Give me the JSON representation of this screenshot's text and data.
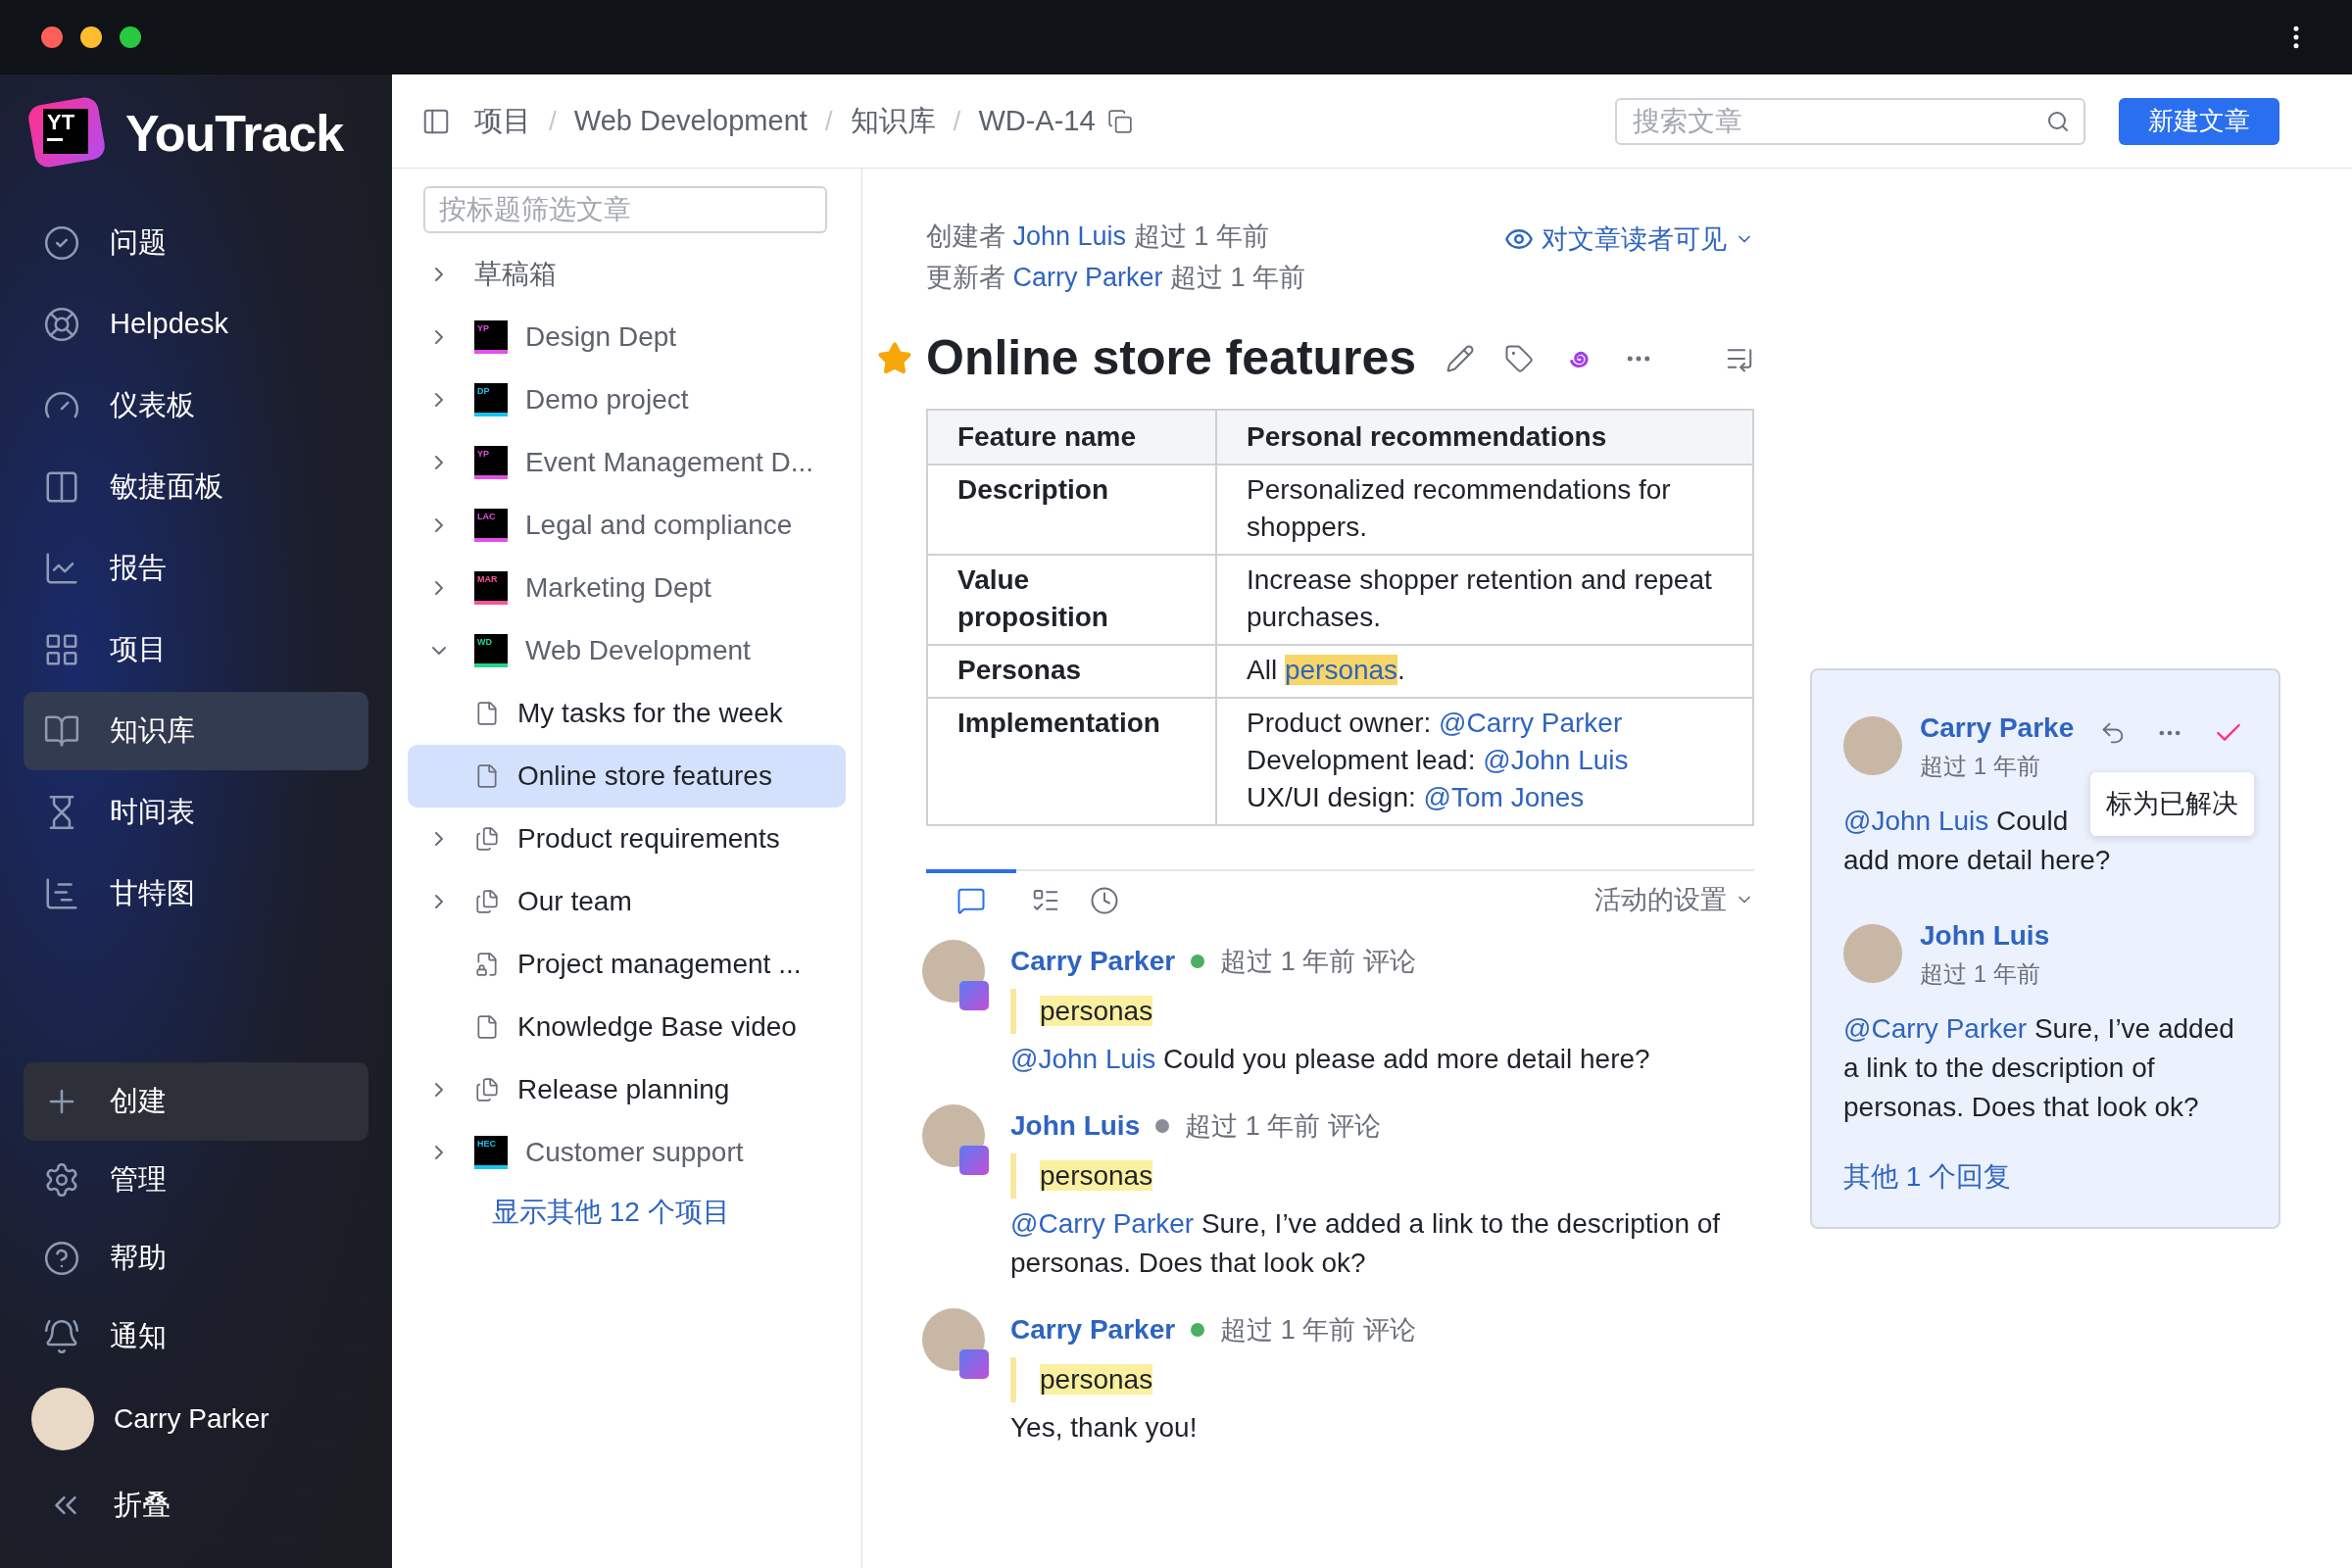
{
  "sidebar": {
    "logo_mark": "YT",
    "logo_text": "YouTrack",
    "nav": [
      {
        "label": "问题",
        "selected": false
      },
      {
        "label": "Helpdesk",
        "selected": false
      },
      {
        "label": "仪表板",
        "selected": false
      },
      {
        "label": "敏捷面板",
        "selected": false
      },
      {
        "label": "报告",
        "selected": false
      },
      {
        "label": "项目",
        "selected": false
      },
      {
        "label": "知识库",
        "selected": true
      },
      {
        "label": "时间表",
        "selected": false
      },
      {
        "label": "甘特图",
        "selected": false
      }
    ],
    "create": {
      "label": "创建"
    },
    "bottom": [
      {
        "label": "管理"
      },
      {
        "label": "帮助"
      },
      {
        "label": "通知"
      }
    ],
    "user": {
      "name": "Carry Parker"
    },
    "collapse": {
      "label": "折叠"
    }
  },
  "header": {
    "breadcrumb": [
      "项目",
      "Web Development",
      "知识库",
      "WD-A-14"
    ],
    "separator": "/",
    "search": {
      "placeholder": "搜索文章"
    },
    "new_button": "新建文章"
  },
  "tree": {
    "filter": {
      "placeholder": "按标题筛选文章"
    },
    "items": [
      {
        "kind": "folder",
        "label": "草稿箱",
        "expanded": false,
        "selected": false
      },
      {
        "kind": "project",
        "label": "Design Dept",
        "badge": "YP",
        "color": "#e34fe8",
        "expanded": false,
        "selected": false
      },
      {
        "kind": "project",
        "label": "Demo project",
        "badge": "DP",
        "color": "#19c3f0",
        "expanded": false,
        "selected": false
      },
      {
        "kind": "project",
        "label": "Event Management D...",
        "badge": "YP",
        "color": "#e34fe8",
        "expanded": false,
        "selected": false
      },
      {
        "kind": "project",
        "label": "Legal and compliance",
        "badge": "LAC",
        "color": "#e34fe8",
        "expanded": false,
        "selected": false
      },
      {
        "kind": "project",
        "label": "Marketing Dept",
        "badge": "MAR",
        "color": "#f2579b",
        "expanded": false,
        "selected": false
      },
      {
        "kind": "project",
        "label": "Web Development",
        "badge": "WD",
        "color": "#21d789",
        "expanded": true,
        "selected": false
      },
      {
        "kind": "article",
        "label": "My tasks for the week",
        "selected": false
      },
      {
        "kind": "article",
        "label": "Online store features",
        "selected": true
      },
      {
        "kind": "group",
        "label": "Product requirements",
        "expanded": false,
        "selected": false
      },
      {
        "kind": "group",
        "label": "Our team",
        "expanded": false,
        "selected": false
      },
      {
        "kind": "locked",
        "label": "Project management ...",
        "selected": false
      },
      {
        "kind": "article",
        "label": "Knowledge Base video",
        "selected": false
      },
      {
        "kind": "group",
        "label": "Release planning",
        "expanded": false,
        "selected": false
      },
      {
        "kind": "project",
        "label": "Customer support",
        "badge": "HEC",
        "color": "#19c3f0",
        "expanded": false,
        "selected": false
      }
    ],
    "more_link": "显示其他 12 个项目"
  },
  "article": {
    "meta": [
      {
        "prefix": "创建者",
        "author": "John Luis",
        "suffix": "超过 1 年前"
      },
      {
        "prefix": "更新者",
        "author": "Carry Parker",
        "suffix": "超过 1 年前"
      }
    ],
    "visibility": "对文章读者可见",
    "starred": true,
    "title": "Online store features",
    "table": {
      "header": [
        "Feature name",
        "Personal recommendations"
      ],
      "rows": [
        {
          "label": "Description",
          "lines": [
            [
              {
                "kind": "text",
                "text": "Personalized recommendations for shoppers."
              }
            ]
          ]
        },
        {
          "label": "Value proposition",
          "lines": [
            [
              {
                "kind": "text",
                "text": "Increase shopper retention and repeat purchases."
              }
            ]
          ]
        },
        {
          "label": "Personas",
          "lines": [
            [
              {
                "kind": "text",
                "text": "All "
              },
              {
                "kind": "highlight",
                "text": "personas"
              },
              {
                "kind": "text",
                "text": "."
              }
            ]
          ]
        },
        {
          "label": "Implementation",
          "lines": [
            [
              {
                "kind": "text",
                "text": "Product owner: "
              },
              {
                "kind": "mention",
                "text": "@Carry Parker"
              }
            ],
            [
              {
                "kind": "text",
                "text": "Development lead: "
              },
              {
                "kind": "mention",
                "text": "@John Luis"
              }
            ],
            [
              {
                "kind": "text",
                "text": "UX/UI design: "
              },
              {
                "kind": "mention",
                "text": "@Tom Jones"
              }
            ]
          ]
        }
      ]
    }
  },
  "activity": {
    "tabs": [
      {
        "selected": true
      },
      {
        "selected": false
      },
      {
        "selected": false
      }
    ],
    "settings": "活动的设置",
    "comments": [
      {
        "author": "Carry Parker",
        "color": "#4caf63",
        "time": "超过 1 年前 评论",
        "quote": "personas",
        "mention": "@John Luis",
        "text": "Could you please add more detail here?"
      },
      {
        "author": "John Luis",
        "color": "#8a8d96",
        "time": "超过 1 年前 评论",
        "quote": "personas",
        "mention": "@Carry Parker",
        "text": "Sure, I’ve added a link to the description of personas. Does that look ok?"
      },
      {
        "author": "Carry Parker",
        "color": "#4caf63",
        "time": "超过 1 年前 评论",
        "quote": "personas",
        "text": "Yes, thank you!"
      }
    ]
  },
  "thread": {
    "tooltip": "标为已解决",
    "comments": [
      {
        "author": "Carry Parke",
        "time": "超过 1 年前",
        "mention": "@John Luis",
        "lines": [
          "Could",
          "add more detail here?"
        ]
      },
      {
        "author": "John Luis",
        "time": "超过 1 年前",
        "mention": "@Carry Parker",
        "lines": [
          "Sure, I’ve added a link to the description of personas. Does that look ok?"
        ]
      }
    ],
    "more_replies": "其他 1 个回复"
  }
}
